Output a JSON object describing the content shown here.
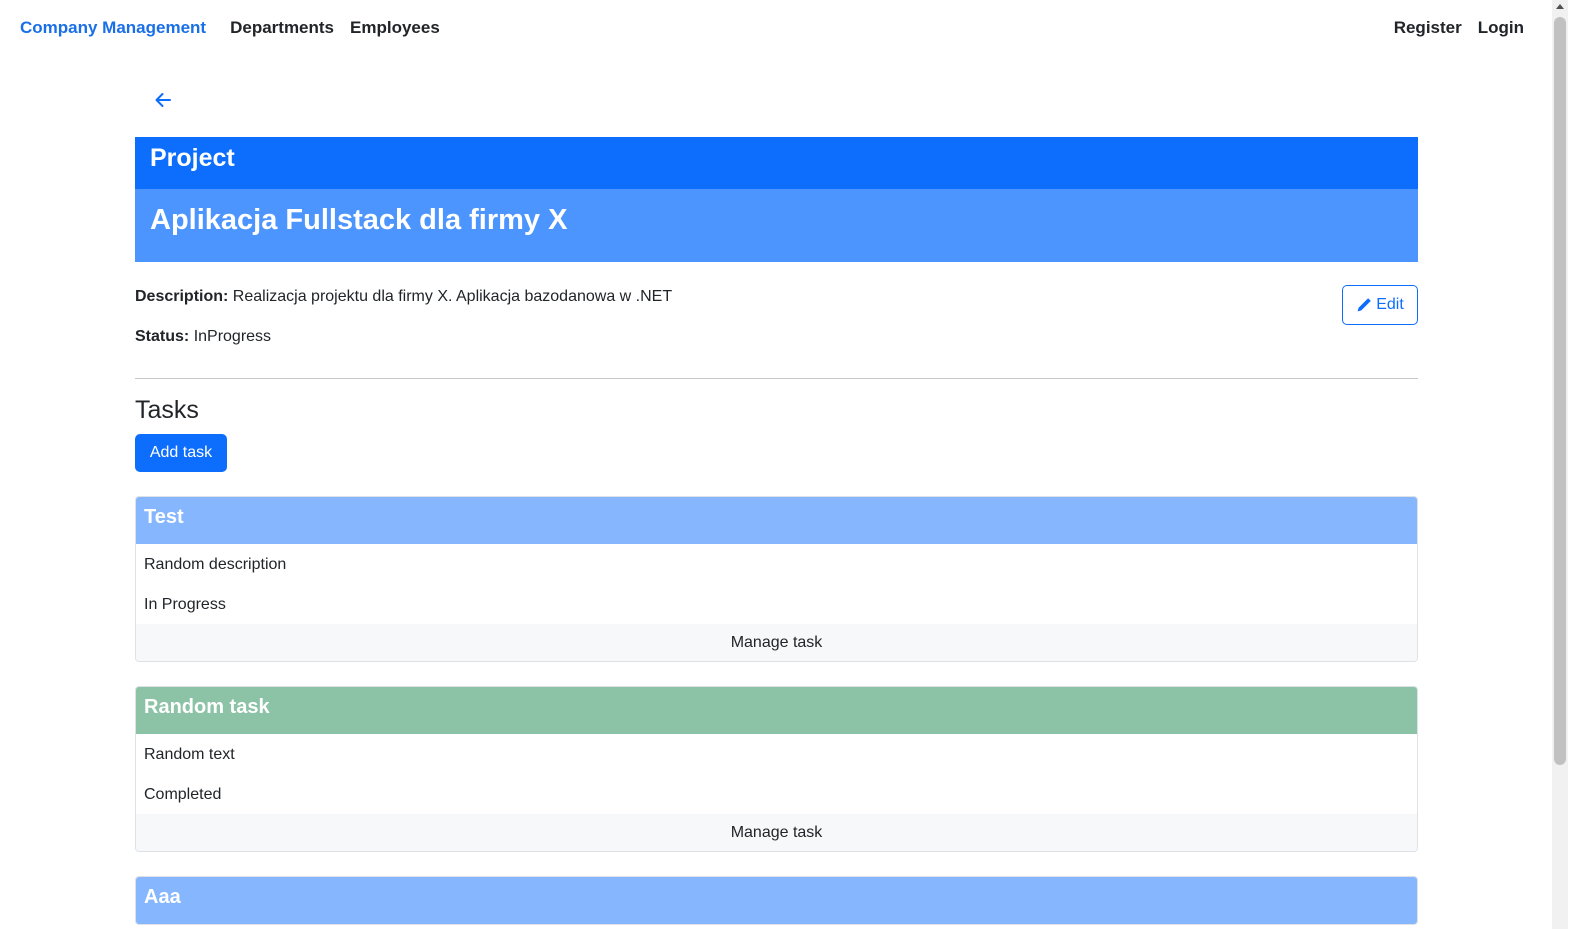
{
  "nav": {
    "brand": "Company Management",
    "links": [
      "Departments",
      "Employees"
    ],
    "register": "Register",
    "login": "Login"
  },
  "colors": {
    "primary": "#0d6efd",
    "task_inprogress": "#86b7fe",
    "task_completed": "#8cc3a6"
  },
  "project": {
    "label": "Project",
    "name": "Aplikacja Fullstack dla firmy X",
    "description_label": "Description:",
    "description": "Realizacja projektu dla firmy X. Aplikacja bazodanowa w .NET",
    "status_label": "Status:",
    "status": "InProgress",
    "edit_label": "Edit"
  },
  "tasks": {
    "title": "Tasks",
    "add_label": "Add task",
    "items": [
      {
        "title": "Test",
        "description": "Random description",
        "status": "In Progress",
        "manage_label": "Manage task",
        "color": "#86b7fe"
      },
      {
        "title": "Random task",
        "description": "Random text",
        "status": "Completed",
        "manage_label": "Manage task",
        "color": "#8cc3a6"
      },
      {
        "title": "Aaa",
        "color": "#86b7fe"
      }
    ]
  }
}
